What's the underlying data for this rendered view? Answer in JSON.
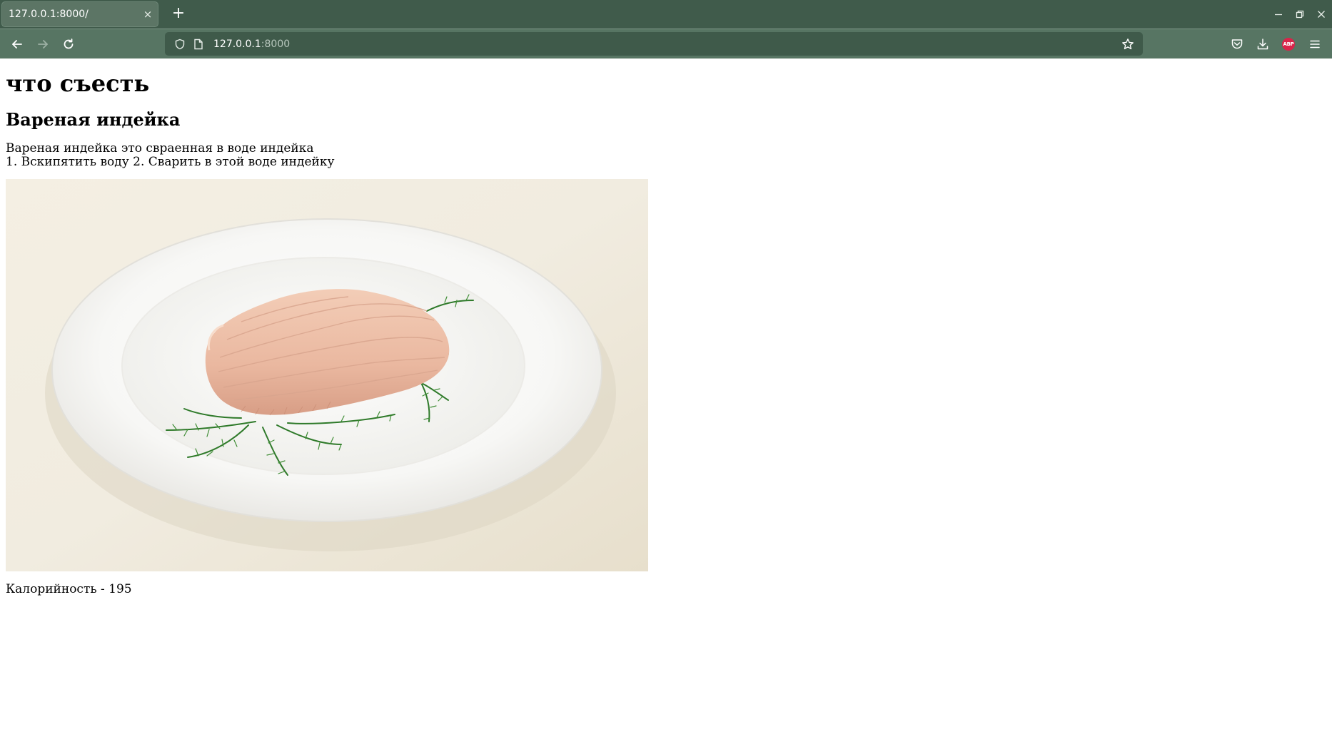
{
  "browser": {
    "tab_title": "127.0.0.1:8000/",
    "tab_close_symbol": "×",
    "new_tab_symbol": "+",
    "url_host": "127.0.0.1",
    "url_port": ":8000",
    "icons": {
      "back": "back-arrow-icon",
      "forward": "forward-arrow-icon",
      "reload": "reload-icon",
      "shield": "tracking-protection-shield-icon",
      "page": "page-info-icon",
      "bookmark": "star-icon",
      "pocket": "pocket-icon",
      "downloads": "download-icon",
      "extension": "adblock-plus-icon",
      "menu": "hamburger-menu-icon",
      "minimize": "minimize-icon",
      "restore": "restore-icon",
      "close": "close-icon"
    },
    "extension_badge": "ABP",
    "colors": {
      "tabstrip": "#405b4b",
      "toolbar": "#577563",
      "urlbar": "#3f5a4a",
      "abp_badge": "#d9244a"
    }
  },
  "page": {
    "site_title": "что съесть",
    "dish_name": "Вареная индейка",
    "description": "Вареная индейка это свраенная в воде индейка",
    "steps": "1. Вскипятить воду 2. Сварить в этой воде индейку",
    "calories": "Калорийность - 195",
    "photo": {
      "subject": "boiled turkey slice with dill on a white plate"
    }
  }
}
